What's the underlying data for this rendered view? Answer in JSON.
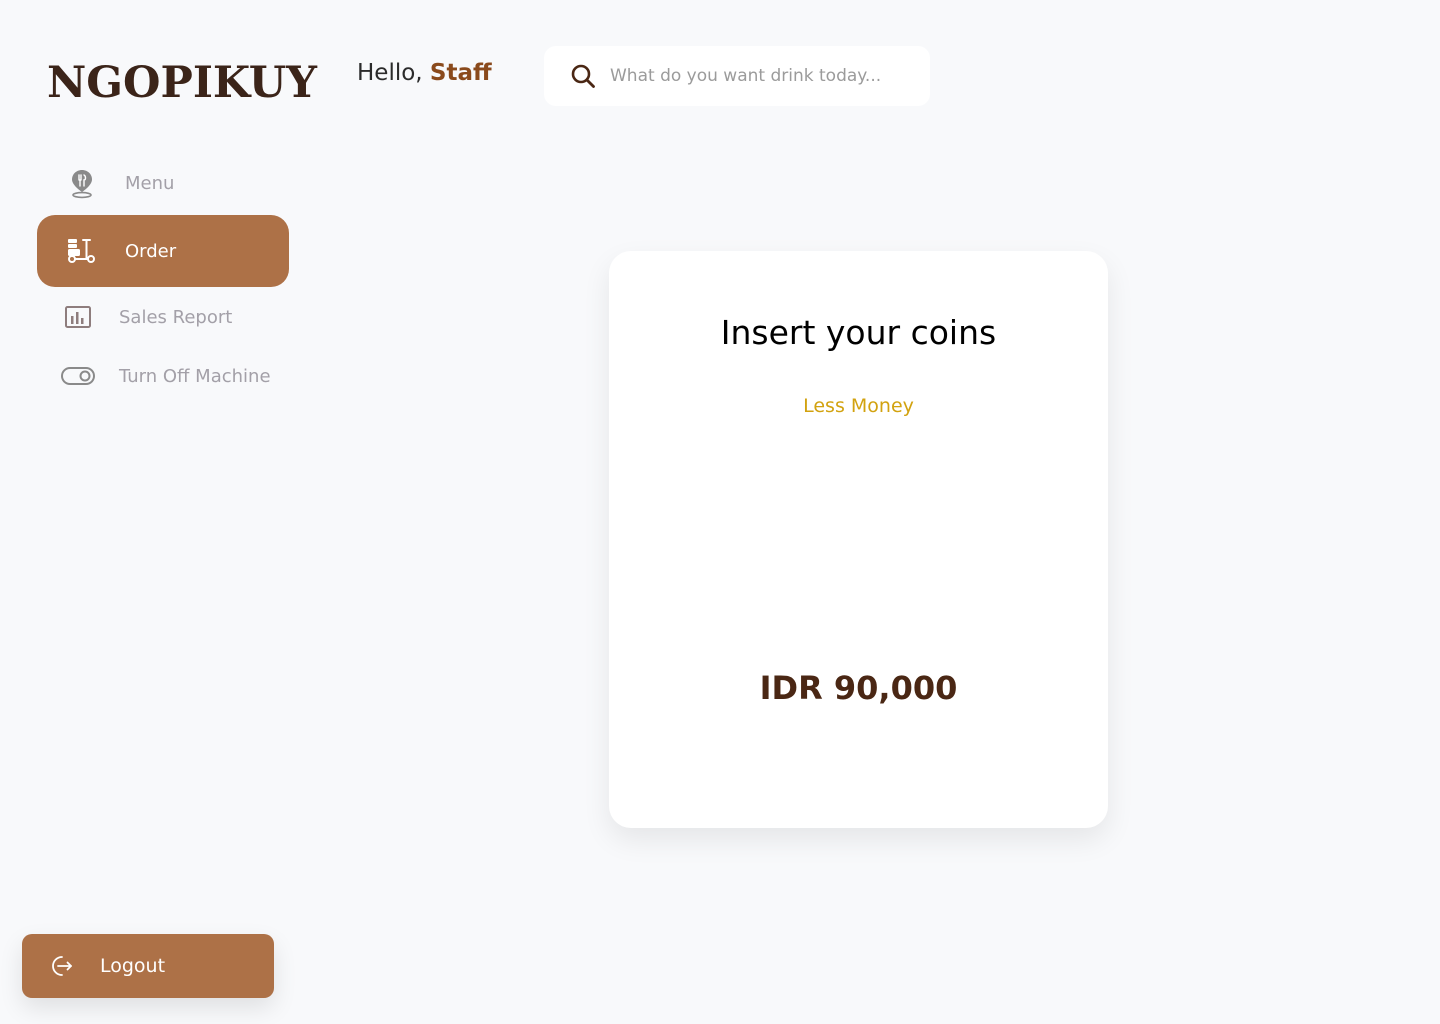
{
  "brand": {
    "name": "NGOPIKUY"
  },
  "header": {
    "greeting": "Hello,",
    "user": "Staff",
    "search_placeholder": "What do you want drink today..."
  },
  "sidebar": {
    "items": [
      {
        "label": "Menu",
        "icon": "location-fork-icon",
        "active": false
      },
      {
        "label": "Order",
        "icon": "delivery-cart-icon",
        "active": true
      },
      {
        "label": "Sales Report",
        "icon": "bar-chart-icon",
        "active": false
      },
      {
        "label": "Turn Off Machine",
        "icon": "toggle-icon",
        "active": false
      }
    ],
    "logout": {
      "label": "Logout",
      "icon": "logout-icon"
    }
  },
  "coin_card": {
    "title": "Insert your coins",
    "status": "Less Money",
    "amount": "IDR 90,000",
    "fill_fraction": 0.35
  },
  "colors": {
    "accent": "#ad7147",
    "brand_text": "#3b2419",
    "status": "#d2a20f",
    "amount": "#4a2714",
    "background": "#f8f9fb"
  }
}
